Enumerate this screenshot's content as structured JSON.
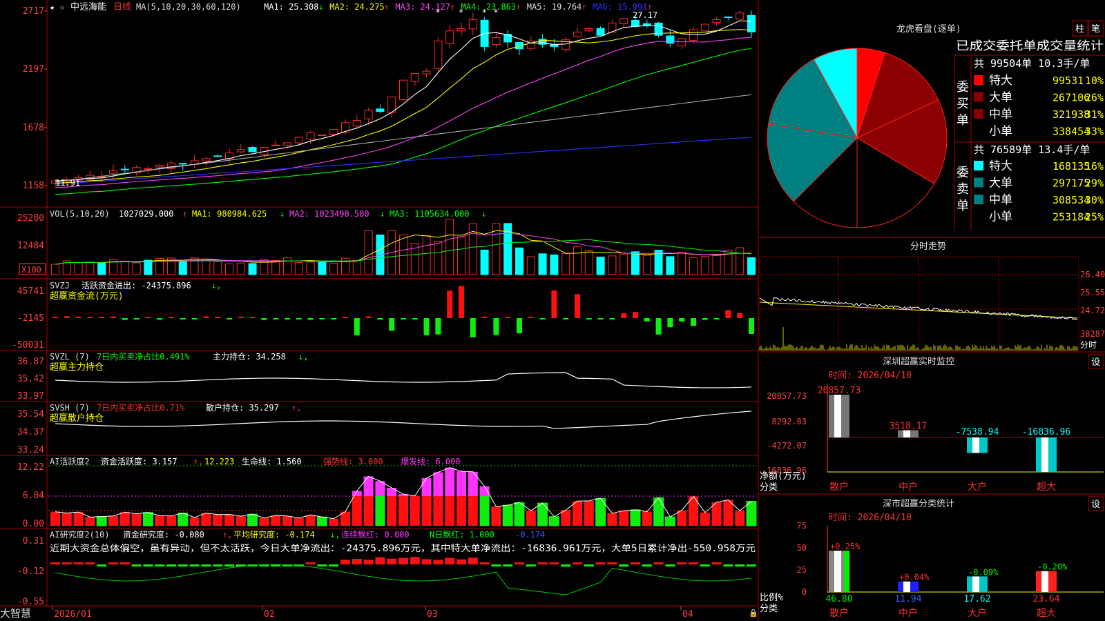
{
  "colors": {
    "up": "#ff2a2a",
    "down": "#00ffff",
    "bg": "#000000",
    "frame": "#aa0000",
    "axis": "#ff4040",
    "ma1": "#ffffff",
    "ma2": "#ffff00",
    "ma3": "#ff44ff",
    "ma4": "#00ff00",
    "ma5": "#aaaaaa",
    "ma6": "#3030ff",
    "green": "#00ee00",
    "magenta": "#ff33ff"
  },
  "header": {
    "star_icons": "★ ☆",
    "stock_name": "中远海能",
    "period": "日线",
    "ma_title": "MA(5,10,20,30,60,120)",
    "ma_values": [
      {
        "label": "MA1: 25.308",
        "arrow": "↓",
        "color": "#ffffff"
      },
      {
        "label": "MA2: 24.275",
        "arrow": "↑",
        "color": "#ffff00"
      },
      {
        "label": "MA3: 24.127",
        "arrow": "↑",
        "color": "#ff44ff"
      },
      {
        "label": "MA4: 23.863",
        "arrow": "↑",
        "color": "#00ff00"
      },
      {
        "label": "MA5: 19.764",
        "arrow": "↑",
        "color": "#dddddd"
      },
      {
        "label": "MA6: 15.991",
        "arrow": "↑",
        "color": "#3030ff"
      }
    ],
    "high_marker": "27.17",
    "low_marker": "11.91"
  },
  "price_axis": [
    "2717",
    "2197",
    "1678",
    "1158"
  ],
  "volume_panel": {
    "title": "VOL(5,10,20)",
    "value": "1027029.000",
    "ma1": "MA1: 980984.625",
    "ma2": "MA2: 1023498.500",
    "ma3": "MA3: 1105634.000",
    "axis": [
      "25280",
      "12484"
    ],
    "unit": "X100"
  },
  "svzj_panel": {
    "title": "SVZJ",
    "line1": "活跃资金进出: -24375.896",
    "line2": "超赢资金流(万元)",
    "axis": [
      "45741",
      "-2145",
      "-50031"
    ]
  },
  "svzl_panel": {
    "title": "SVZL (7)",
    "pct": "7日内买卖净占比0.491%",
    "hold": "主力持仓: 34.258",
    "line2": "超赢主力持仓",
    "axis": [
      "36.87",
      "35.42",
      "33.97"
    ]
  },
  "svsh_panel": {
    "title": "SVSH (7)",
    "pct": "7日内买卖净占比0.71%",
    "hold": "散户持仓: 35.297",
    "line2": "超赢散户持仓",
    "axis": [
      "35.54",
      "34.37",
      "33.24"
    ]
  },
  "ai_active_panel": {
    "title": "AI活跃度2",
    "v1": "资金活跃度: 3.157",
    "v2": "12.223",
    "v3": "生命线: 1.560",
    "v4": "强势线: 3.000",
    "v5": "爆发线: 6.000",
    "axis": [
      "12.22",
      "6.04",
      "0.00"
    ]
  },
  "ai_research_panel": {
    "title": "AI研究度2(10)",
    "v1": "资金研究度: -0.080",
    "v2": "平均研究度: -0.174",
    "v3": "连续飘红: 0.000",
    "v4": "N日飘红: 1.000",
    "v5": "-0.174",
    "commentary": "近期大资金总体偏空，虽有异动，但不太活跃，今日大单净流出：-24375.896万元，其中特大单净流出：-16836.961万元，大单5日累计净出-550.958万元",
    "axis": [
      "0.31",
      "-0.12",
      "-0.55"
    ]
  },
  "date_axis": [
    "2026/01",
    "02",
    "03",
    "04"
  ],
  "bottom_tab": "大智慧",
  "dragon": {
    "title": "龙虎看盘(逐单)",
    "btn_bar": "柱",
    "btn_pen": "笔",
    "stats_title": "已成交委托单成交量统计",
    "buy_label": "委买单",
    "sell_label": "委卖单",
    "buy_total": "共 99504单 10.3手/单",
    "sell_total": "共 76589单 13.4手/单",
    "buy_rows": [
      {
        "name": "特大",
        "value": "99531",
        "pct": "10%",
        "color": "#ff0000"
      },
      {
        "name": "大单",
        "value": "267106",
        "pct": "26%",
        "color": "#8b0000"
      },
      {
        "name": "中单",
        "value": "321938",
        "pct": "31%",
        "color": "#8b0000"
      },
      {
        "name": "小单",
        "value": "338454",
        "pct": "33%",
        "color": "#000000"
      }
    ],
    "sell_rows": [
      {
        "name": "特大",
        "value": "168135",
        "pct": "16%",
        "color": "#00ffff"
      },
      {
        "name": "大单",
        "value": "297175",
        "pct": "29%",
        "color": "#008080"
      },
      {
        "name": "中单",
        "value": "308534",
        "pct": "30%",
        "color": "#008080"
      },
      {
        "name": "小单",
        "value": "253184",
        "pct": "25%",
        "color": "#000000"
      }
    ]
  },
  "intraday": {
    "title": "分时走势",
    "axis": [
      "26.40",
      "25.55",
      "24.72",
      "38287"
    ],
    "unit": "分时"
  },
  "sz_monitor": {
    "title": "深圳超赢实时监控",
    "set": "设",
    "time": "时间: 2026/04/10",
    "axis": [
      "20857.73",
      "8292.83",
      "-4272.07",
      "-16836.96"
    ],
    "ylabel": "净额(万元)",
    "xlabel": "分类",
    "bars": [
      {
        "name": "散户",
        "value": 20857.73,
        "label": "20857.73"
      },
      {
        "name": "中户",
        "value": 3518.17,
        "label": "3518.17"
      },
      {
        "name": "大户",
        "value": -7538.94,
        "label": "-7538.94"
      },
      {
        "name": "超大",
        "value": -16836.96,
        "label": "-16836.96"
      }
    ]
  },
  "sz_category": {
    "title": "深市超赢分类统计",
    "set": "设",
    "time": "时间: 2026/04/10",
    "axis": [
      "75",
      "50",
      "25",
      "0"
    ],
    "ylabel": "比例%",
    "xlabel": "分类",
    "bars": [
      {
        "name": "散户",
        "value": 46.8,
        "label": "46.80",
        "chg": "+0.25%"
      },
      {
        "name": "中户",
        "value": 11.94,
        "label": "11.94",
        "chg": "+0.04%"
      },
      {
        "name": "大户",
        "value": 17.62,
        "label": "17.62",
        "chg": "-0.09%"
      },
      {
        "name": "超大",
        "value": 23.64,
        "label": "23.64",
        "chg": "-0.20%"
      }
    ]
  }
}
